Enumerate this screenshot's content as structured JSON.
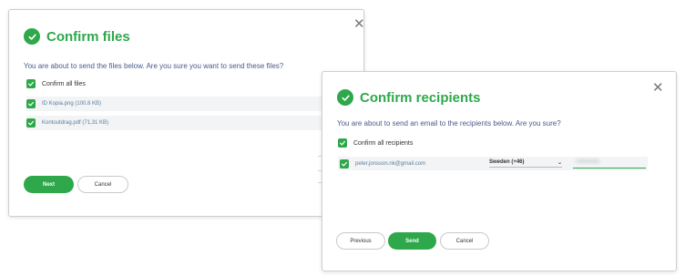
{
  "files_dialog": {
    "title": "Confirm files",
    "prompt": "You are about to send the files below. Are you sure you want to send these files?",
    "confirm_all_label": "Confirm all files",
    "files": [
      {
        "name": "ID Kopia.png (100.8 KB)",
        "checked": true
      },
      {
        "name": "Kontoutdrag.pdf (71,31 KB)",
        "checked": true
      }
    ],
    "buttons": {
      "next": "Next",
      "cancel": "Cancel"
    },
    "close_glyph": "✕"
  },
  "recipients_dialog": {
    "title": "Confirm recipients",
    "prompt": "You are about to send an email to the recipients below. Are you sure?",
    "confirm_all_label": "Confirm all recipients",
    "recipients": [
      {
        "email": "peter.jonsson.nk@gmail.com",
        "country": "Sweden (+46)",
        "phone": "70000000",
        "checked": true
      }
    ],
    "buttons": {
      "previous": "Previous",
      "send": "Send",
      "cancel": "Cancel"
    },
    "close_glyph": "✕",
    "dropdown_glyph": "⌄"
  },
  "colors": {
    "accent": "#2ea84a",
    "prompt_text": "#4a5a8a",
    "file_text": "#5b7d9a"
  }
}
